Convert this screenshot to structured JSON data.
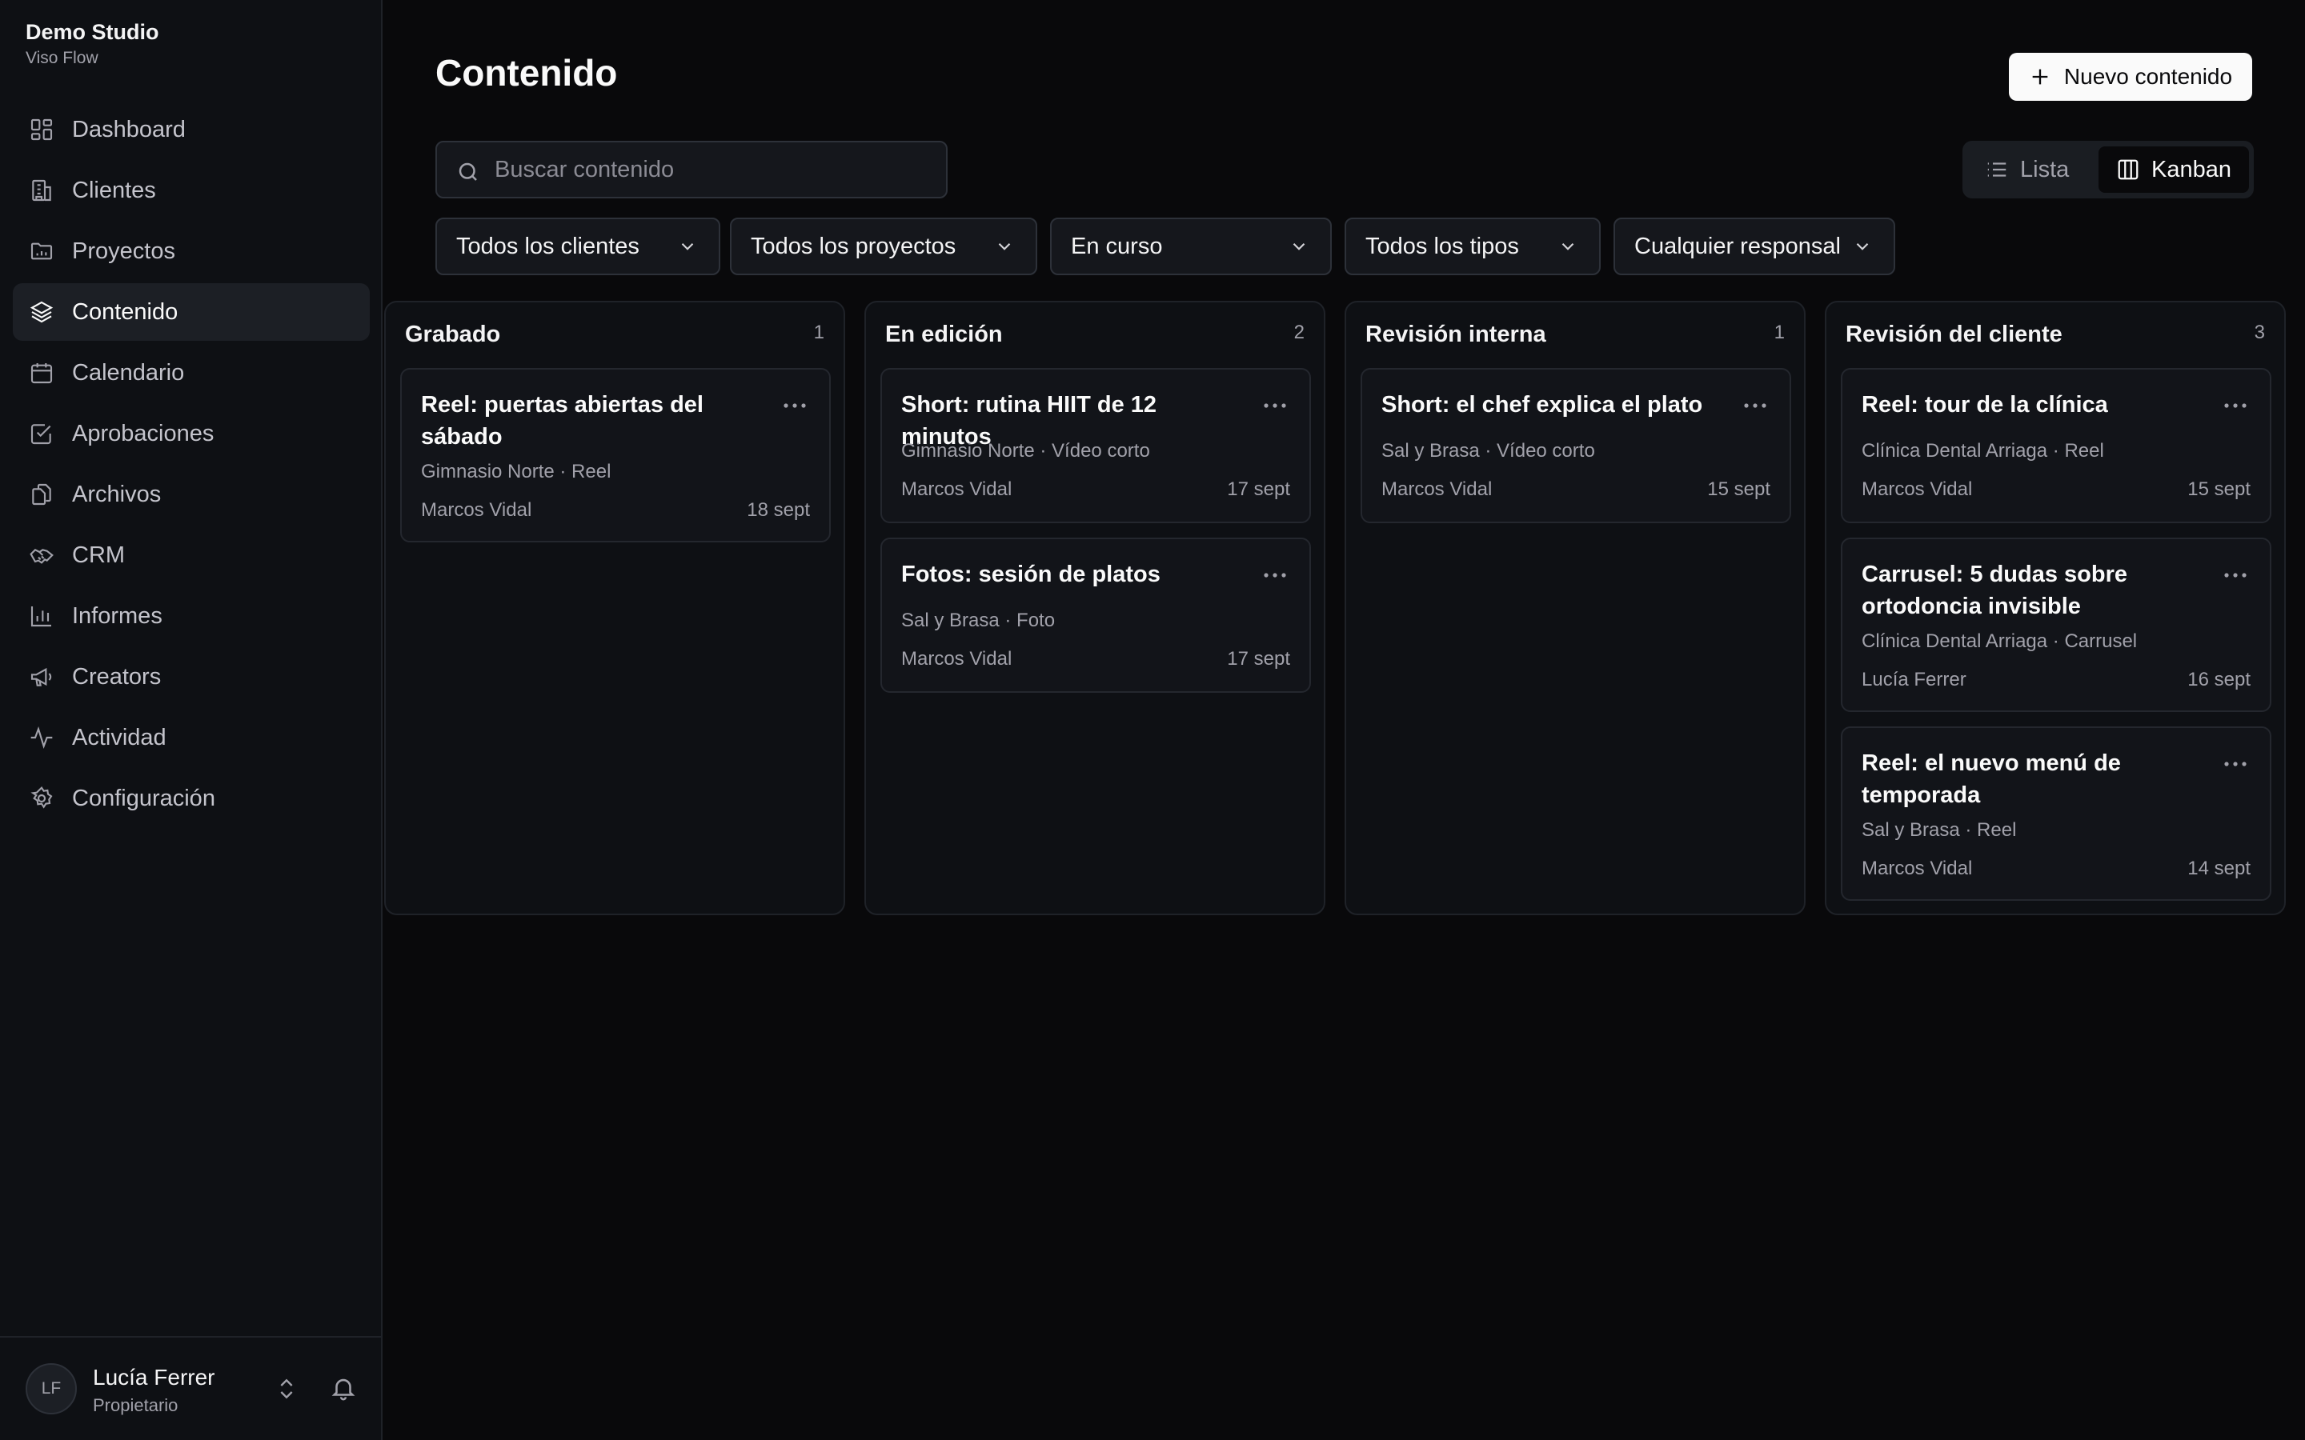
{
  "brand": {
    "name": "Demo Studio",
    "product": "Viso Flow"
  },
  "nav": [
    {
      "label": "Dashboard",
      "icon": "dashboard-icon"
    },
    {
      "label": "Clientes",
      "icon": "building-icon"
    },
    {
      "label": "Proyectos",
      "icon": "folder-icon"
    },
    {
      "label": "Contenido",
      "icon": "layers-icon",
      "active": true
    },
    {
      "label": "Calendario",
      "icon": "calendar-icon"
    },
    {
      "label": "Aprobaciones",
      "icon": "check-square-icon"
    },
    {
      "label": "Archivos",
      "icon": "files-icon"
    },
    {
      "label": "CRM",
      "icon": "handshake-icon"
    },
    {
      "label": "Informes",
      "icon": "bar-chart-icon"
    },
    {
      "label": "Creators",
      "icon": "megaphone-icon"
    },
    {
      "label": "Actividad",
      "icon": "activity-icon"
    },
    {
      "label": "Configuración",
      "icon": "gear-icon"
    }
  ],
  "user": {
    "initials": "LF",
    "name": "Lucía Ferrer",
    "role": "Propietario"
  },
  "page": {
    "title": "Contenido",
    "new_button": "Nuevo contenido"
  },
  "search": {
    "placeholder": "Buscar contenido",
    "value": ""
  },
  "view": {
    "list": "Lista",
    "kanban": "Kanban",
    "selected": "Kanban"
  },
  "filters": {
    "client": "Todos los clientes",
    "project": "Todos los proyectos",
    "status": "En curso",
    "type": "Todos los tipos",
    "owner": "Cualquier responsal"
  },
  "columns": [
    {
      "title": "Grabado",
      "count": "1",
      "cards": [
        {
          "title": "Reel: puertas abiertas del sábado",
          "meta": "Gimnasio Norte · Reel",
          "owner": "Marcos Vidal",
          "date": "18 sept"
        }
      ]
    },
    {
      "title": "En edición",
      "count": "2",
      "cards": [
        {
          "title": "Short: rutina HIIT de 12 minutos",
          "meta": "Gimnasio Norte · Vídeo corto",
          "owner": "Marcos Vidal",
          "date": "17 sept"
        },
        {
          "title": "Fotos: sesión de platos",
          "meta": "Sal y Brasa · Foto",
          "owner": "Marcos Vidal",
          "date": "17 sept"
        }
      ]
    },
    {
      "title": "Revisión interna",
      "count": "1",
      "cards": [
        {
          "title": "Short: el chef explica el plato",
          "meta": "Sal y Brasa · Vídeo corto",
          "owner": "Marcos Vidal",
          "date": "15 sept"
        }
      ]
    },
    {
      "title": "Revisión del cliente",
      "count": "3",
      "cards": [
        {
          "title": "Reel: tour de la clínica",
          "meta": "Clínica Dental Arriaga · Reel",
          "owner": "Marcos Vidal",
          "date": "15 sept"
        },
        {
          "title": "Carrusel: 5 dudas sobre ortodoncia invisible",
          "meta": "Clínica Dental Arriaga · Carrusel",
          "owner": "Lucía Ferrer",
          "date": "16 sept"
        },
        {
          "title": "Reel: el nuevo menú de temporada",
          "meta": "Sal y Brasa · Reel",
          "owner": "Marcos Vidal",
          "date": "14 sept"
        }
      ]
    }
  ]
}
